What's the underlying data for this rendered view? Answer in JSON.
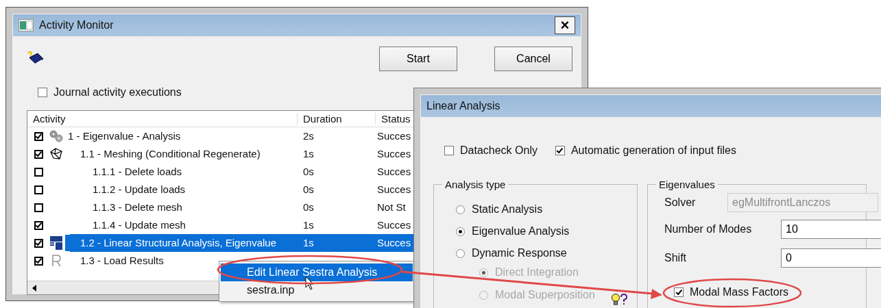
{
  "activity_window": {
    "title": "Activity Monitor",
    "close_label": "×",
    "buttons": [
      "Start",
      "Cancel"
    ],
    "journal": {
      "label": "Journal activity executions",
      "checked": false
    },
    "columns": [
      "Activity",
      "Duration",
      "Status"
    ],
    "rows": [
      {
        "kind": "gears",
        "label": "1 - Eigenvalue - Analysis",
        "duration": "2s",
        "status": "Succes",
        "checked": true,
        "selected": false,
        "children": [
          {
            "kind": "mesh",
            "label": "1.1 - Meshing (Conditional Regenerate)",
            "duration": "1s",
            "status": "Succes",
            "checked": true,
            "selected": false,
            "children": [
              {
                "label": "1.1.1 - Delete loads",
                "duration": "0s",
                "status": "Succes",
                "checked": false,
                "selected": false
              },
              {
                "label": "1.1.2 - Update loads",
                "duration": "0s",
                "status": "Succes",
                "checked": false,
                "selected": false
              },
              {
                "label": "1.1.3 - Delete mesh",
                "duration": "0s",
                "status": "Not St",
                "checked": false,
                "selected": false
              },
              {
                "label": "1.1.4 - Update mesh",
                "duration": "1s",
                "status": "Succes",
                "checked": true,
                "selected": false
              }
            ]
          },
          {
            "kind": "kr",
            "label": "1.2 - Linear Structural Analysis, Eigenvalue",
            "duration": "1s",
            "status": "Succes",
            "checked": true,
            "selected": true
          },
          {
            "kind": "r",
            "label": "1.3 - Load Results",
            "checked": true,
            "selected": false
          }
        ]
      }
    ],
    "context_menu": [
      {
        "label": "Edit Linear Sestra Analysis",
        "selected": true
      },
      {
        "label": "sestra.inp",
        "selected": false
      }
    ]
  },
  "linear_window": {
    "title": "Linear Analysis",
    "options": [
      {
        "label": "Datacheck Only",
        "checked": false
      },
      {
        "label": "Automatic generation of input files",
        "checked": true
      }
    ],
    "analysis_type": {
      "title": "Analysis type",
      "items": [
        {
          "label": "Static Analysis",
          "selected": false,
          "disabled": false
        },
        {
          "label": "Eigenvalue Analysis",
          "selected": true,
          "disabled": false
        },
        {
          "label": "Dynamic Response",
          "selected": false,
          "disabled": false,
          "children": [
            {
              "label": "Direct Integration",
              "selected": true,
              "disabled": true
            },
            {
              "label": "Modal Superposition",
              "selected": false,
              "disabled": true
            }
          ]
        }
      ]
    },
    "eigenvalues": {
      "title": "Eigenvalues",
      "fields": [
        {
          "label": "Solver",
          "value": "egMultifrontLanczos",
          "disabled": true
        },
        {
          "label": "Number of Modes",
          "value": "10",
          "disabled": false
        },
        {
          "label": "Shift",
          "value": "0",
          "disabled": false
        }
      ],
      "modal_mass": {
        "label": "Modal Mass Factors",
        "checked": true
      }
    }
  }
}
